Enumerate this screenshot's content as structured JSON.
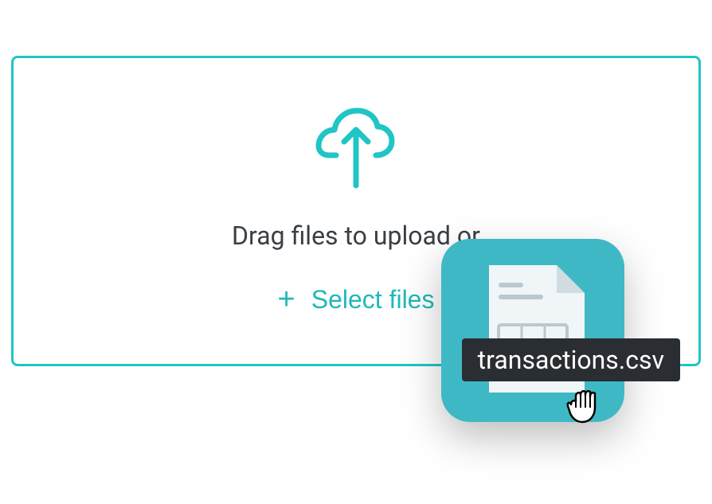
{
  "dropzone": {
    "instruction_text": "Drag files to upload or",
    "select_button_label": "Select files"
  },
  "file": {
    "name": "transactions.csv"
  },
  "colors": {
    "accent": "#20c5c5",
    "file_card_bg": "#3fb8c5",
    "text": "#3a3f44",
    "filename_bg": "#2a2e33"
  }
}
